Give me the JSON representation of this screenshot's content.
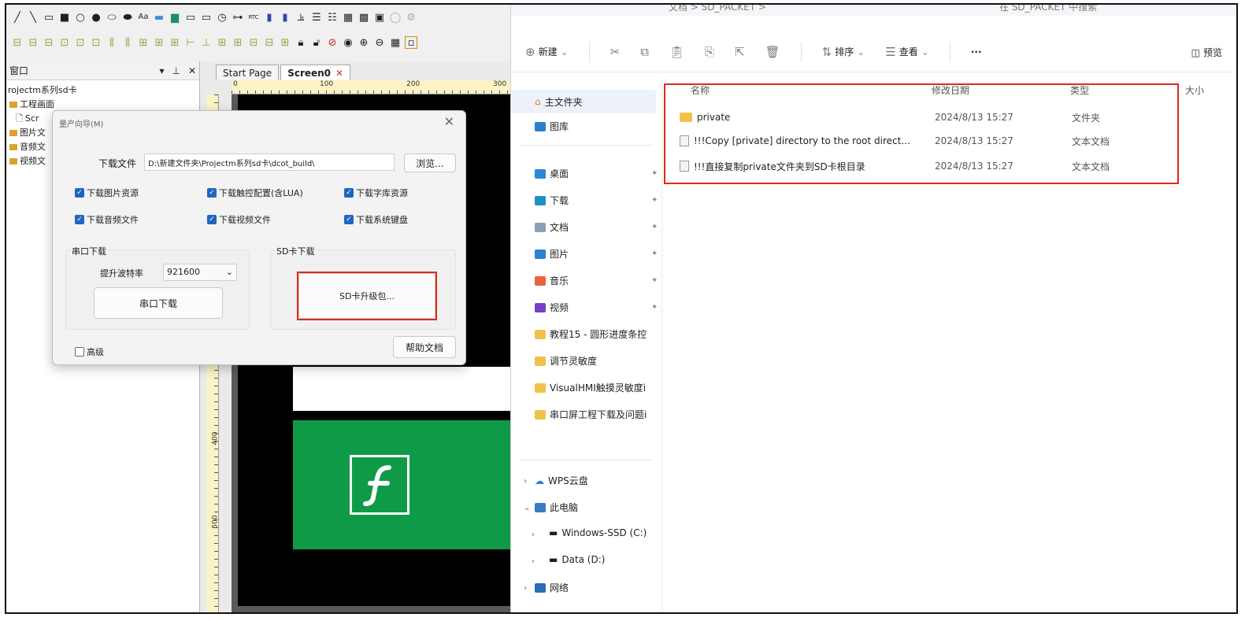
{
  "designer": {
    "project_panel_title": "窗口",
    "doc_tabs": [
      {
        "label": "Start Page"
      },
      {
        "label": "Screen0"
      }
    ],
    "tree": [
      "rojectm系列sd卡",
      "工程画面",
      "Scr",
      "图片文",
      "音频文",
      "视频文"
    ],
    "ruler_top": [
      "0",
      "100",
      "200",
      "300"
    ],
    "ruler_left": [
      "400",
      "500"
    ]
  },
  "dialog": {
    "title": "量产向导(M)",
    "download_file_label": "下载文件",
    "download_path": "D:\\新建文件夹\\Projectm系列sd卡\\dcot_build\\",
    "browse_button": "浏览...",
    "checkboxes": [
      {
        "label": "下载图片资源",
        "checked": true
      },
      {
        "label": "下载触控配置(含LUA)",
        "checked": true
      },
      {
        "label": "下载字库资源",
        "checked": true
      },
      {
        "label": "下载音频文件",
        "checked": true
      },
      {
        "label": "下载视频文件",
        "checked": true
      },
      {
        "label": "下载系统键盘",
        "checked": true
      }
    ],
    "serial_group": "串口下载",
    "baud_label": "提升波特率",
    "baud_value": "921600",
    "serial_button": "串口下载",
    "sd_group": "SD卡下载",
    "sd_button": "SD卡升级包...",
    "advanced_label": "高级",
    "advanced_checked": false,
    "help_button": "帮助文档"
  },
  "explorer": {
    "address_crumbs": "文档  >  SD_PACKET  >",
    "search_placeholder": "在 SD_PACKET 中搜索",
    "toolbar": {
      "new_label": "新建",
      "sort_label": "排序",
      "view_label": "查看",
      "more_label": "···",
      "preview_label": "预览"
    },
    "nav": {
      "home": "主文件夹",
      "gallery": "图库",
      "quick": [
        {
          "label": "桌面",
          "color": "#2b87d8"
        },
        {
          "label": "下载",
          "color": "#1e90c8"
        },
        {
          "label": "文档",
          "color": "#8aa0b8"
        },
        {
          "label": "图片",
          "color": "#2f7fd0"
        },
        {
          "label": "音乐",
          "color": "#e8643c"
        },
        {
          "label": "视频",
          "color": "#7a3fc8"
        },
        {
          "label": "教程15 - 圆形进度条控",
          "color": "#f1c14b"
        },
        {
          "label": "调节灵敏度",
          "color": "#f1c14b"
        },
        {
          "label": "VisualHMI触摸灵敏度i",
          "color": "#f1c14b"
        },
        {
          "label": "串口屏工程下载及问题i",
          "color": "#f1c14b"
        }
      ],
      "wps": "WPS云盘",
      "this_pc": "此电脑",
      "drive_c": "Windows-SSD (C:)",
      "drive_d": "Data (D:)",
      "network": "网络"
    },
    "columns": {
      "name": "名称",
      "date": "修改日期",
      "type": "类型",
      "size": "大小"
    },
    "files": [
      {
        "name": "private",
        "date": "2024/8/13 15:27",
        "type": "文件夹",
        "kind": "folder"
      },
      {
        "name": "!!!Copy [private] directory to the root direct...",
        "date": "2024/8/13 15:27",
        "type": "文本文档",
        "kind": "doc"
      },
      {
        "name": "!!!直接复制private文件夹到SD卡根目录",
        "date": "2024/8/13 15:27",
        "type": "文本文档",
        "kind": "doc"
      }
    ]
  },
  "colors": {
    "highlight_red": "#e0271c",
    "checkbox_blue": "#1f66c1",
    "screen_green": "#0f9a47"
  }
}
